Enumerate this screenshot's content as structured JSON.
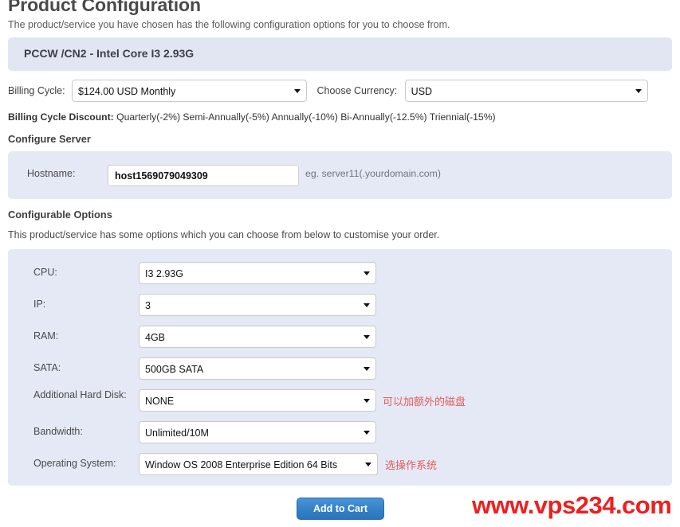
{
  "header": {
    "title": "Product Configuration",
    "subtitle": "The product/service you have chosen has the following configuration options for you to choose from."
  },
  "product_banner": {
    "title": "PCCW /CN2 - Intel Core I3 2.93G"
  },
  "billing": {
    "cycle_label": "Billing Cycle:",
    "cycle_value": "$124.00 USD Monthly",
    "currency_label": "Choose Currency:",
    "currency_value": "USD",
    "discount_label": "Billing Cycle Discount:",
    "discount_value": "Quarterly(-2%) Semi-Annually(-5%) Annually(-10%) Bi-Annually(-12.5%) Triennial(-15%)"
  },
  "configure_server": {
    "heading": "Configure Server",
    "hostname_label": "Hostname:",
    "hostname_value": "host1569079049309",
    "hostname_placeholder": "",
    "hostname_hint": "eg. server11(.yourdomain.com)"
  },
  "configurable_options": {
    "heading": "Configurable Options",
    "description": "This product/service has some options which you can choose from below to customise your order.",
    "options": [
      {
        "label": "CPU:",
        "value": "I3 2.93G",
        "annotation": ""
      },
      {
        "label": "IP:",
        "value": "3",
        "annotation": ""
      },
      {
        "label": "RAM:",
        "value": "4GB",
        "annotation": ""
      },
      {
        "label": "SATA:",
        "value": "500GB SATA",
        "annotation": ""
      },
      {
        "label": "Additional Hard Disk:",
        "value": "NONE",
        "annotation": "可以加额外的磁盘"
      },
      {
        "label": "Bandwidth:",
        "value": "Unlimited/10M",
        "annotation": ""
      },
      {
        "label": "Operating System:",
        "value": "Window OS 2008 Enterprise Edition 64 Bits",
        "annotation": "选操作系统"
      }
    ]
  },
  "footer": {
    "add_to_cart_label": "Add to Cart",
    "watermark": "www.vps234.com"
  },
  "colors": {
    "panel_background": "#e5e9f5",
    "banner_background": "#e2e6f3",
    "button_blue": "#3683c9",
    "annotation_red": "#e45b5b",
    "watermark_red": "#f01e1e"
  }
}
